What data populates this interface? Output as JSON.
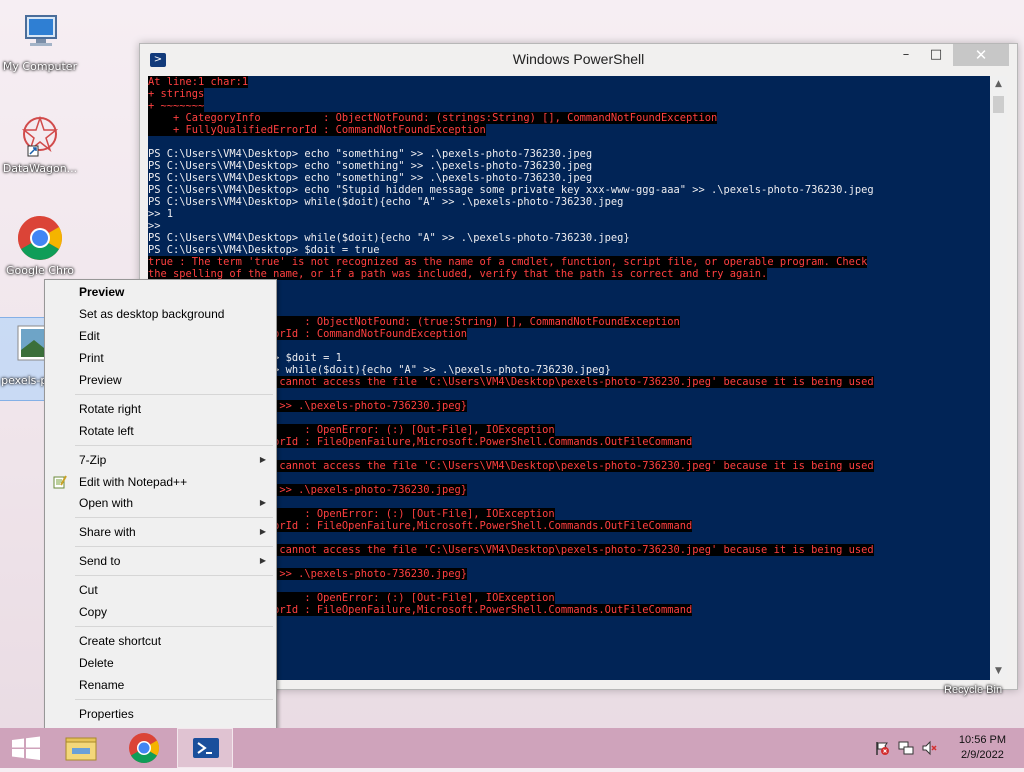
{
  "desktop": {
    "icons": [
      {
        "label": "My Computer"
      },
      {
        "label": "DataWagon..."
      },
      {
        "label": "Google Chro"
      },
      {
        "label": "pexels-p 7362"
      }
    ],
    "recycle_bin": "Recycle Bin"
  },
  "window": {
    "title": "Windows PowerShell",
    "min_glyph": "–",
    "max_glyph": "□",
    "close_glyph": "✕"
  },
  "console": {
    "lines": [
      {
        "t": "At line:1 char:1",
        "err": true
      },
      {
        "t": "+ strings",
        "err": true
      },
      {
        "t": "+ ~~~~~~~",
        "err": true
      },
      {
        "t": "    + CategoryInfo          : ObjectNotFound: (strings:String) [], CommandNotFoundException",
        "err": true
      },
      {
        "t": "    + FullyQualifiedErrorId : CommandNotFoundException",
        "err": true
      },
      {
        "t": " ",
        "err": false
      },
      {
        "t": "PS C:\\Users\\VM4\\Desktop> echo \"something\" >> .\\pexels-photo-736230.jpeg",
        "err": false
      },
      {
        "t": "PS C:\\Users\\VM4\\Desktop> echo \"something\" >> .\\pexels-photo-736230.jpeg",
        "err": false
      },
      {
        "t": "PS C:\\Users\\VM4\\Desktop> echo \"something\" >> .\\pexels-photo-736230.jpeg",
        "err": false
      },
      {
        "t": "PS C:\\Users\\VM4\\Desktop> echo \"Stupid hidden message some private key xxx-www-ggg-aaa\" >> .\\pexels-photo-736230.jpeg",
        "err": false
      },
      {
        "t": "PS C:\\Users\\VM4\\Desktop> while($doit){echo \"A\" >> .\\pexels-photo-736230.jpeg",
        "err": false
      },
      {
        "t": ">> 1",
        "err": false
      },
      {
        "t": ">>",
        "err": false
      },
      {
        "t": "PS C:\\Users\\VM4\\Desktop> while($doit){echo \"A\" >> .\\pexels-photo-736230.jpeg}",
        "err": false
      },
      {
        "t": "PS C:\\Users\\VM4\\Desktop> $doit = true",
        "err": false
      },
      {
        "t": "true : The term 'true' is not recognized as the name of a cmdlet, function, script file, or operable program. Check",
        "err": true
      },
      {
        "t": "the spelling of the name, or if a path was included, verify that the path is correct and try again.",
        "err": true
      },
      {
        "t": " ",
        "err": false
      },
      {
        "t": " ",
        "err": false
      },
      {
        "t": " ",
        "err": false
      },
      {
        "t": "                         : ObjectNotFound: (true:String) [], CommandNotFoundException",
        "err": true
      },
      {
        "t": "               edErrorId : CommandNotFoundException",
        "err": true
      },
      {
        "t": " ",
        "err": false
      },
      {
        "t": "               sktop> $doit = 1",
        "err": false
      },
      {
        "t": "               sktop> while($doit){echo \"A\" >> .\\pexels-photo-736230.jpeg}",
        "err": false
      },
      {
        "t": "               ccess cannot access the file 'C:\\Users\\VM4\\Desktop\\pexels-photo-736230.jpeg' because it is being used",
        "err": true
      },
      {
        "t": " ",
        "err": false
      },
      {
        "t": "               o \"A\" >> .\\pexels-photo-736230.jpeg}",
        "err": true
      },
      {
        "t": " ",
        "err": false
      },
      {
        "t": "                         : OpenError: (:) [Out-File], IOException",
        "err": true
      },
      {
        "t": "               edErrorId : FileOpenFailure,Microsoft.PowerShell.Commands.OutFileCommand",
        "err": true
      },
      {
        "t": " ",
        "err": false
      },
      {
        "t": "               ccess cannot access the file 'C:\\Users\\VM4\\Desktop\\pexels-photo-736230.jpeg' because it is being used",
        "err": true
      },
      {
        "t": " ",
        "err": false
      },
      {
        "t": "               o \"A\" >> .\\pexels-photo-736230.jpeg}",
        "err": true
      },
      {
        "t": " ",
        "err": false
      },
      {
        "t": "                         : OpenError: (:) [Out-File], IOException",
        "err": true
      },
      {
        "t": "               edErrorId : FileOpenFailure,Microsoft.PowerShell.Commands.OutFileCommand",
        "err": true
      },
      {
        "t": " ",
        "err": false
      },
      {
        "t": "               ccess cannot access the file 'C:\\Users\\VM4\\Desktop\\pexels-photo-736230.jpeg' because it is being used",
        "err": true
      },
      {
        "t": " ",
        "err": false
      },
      {
        "t": "               o \"A\" >> .\\pexels-photo-736230.jpeg}",
        "err": true
      },
      {
        "t": " ",
        "err": false
      },
      {
        "t": "                         : OpenError: (:) [Out-File], IOException",
        "err": true
      },
      {
        "t": "               edErrorId : FileOpenFailure,Microsoft.PowerShell.Commands.OutFileCommand",
        "err": true
      }
    ]
  },
  "context_menu": {
    "items": [
      "Preview",
      "Set as desktop background",
      "Edit",
      "Print",
      "Preview",
      "Rotate right",
      "Rotate left",
      "7-Zip",
      "Edit with Notepad++",
      "Open with",
      "Share with",
      "Send to",
      "Cut",
      "Copy",
      "Create shortcut",
      "Delete",
      "Rename",
      "Properties"
    ],
    "submenu_arrow": "▶"
  },
  "taskbar": {
    "time": "10:56 PM",
    "date": "2/9/2022"
  }
}
